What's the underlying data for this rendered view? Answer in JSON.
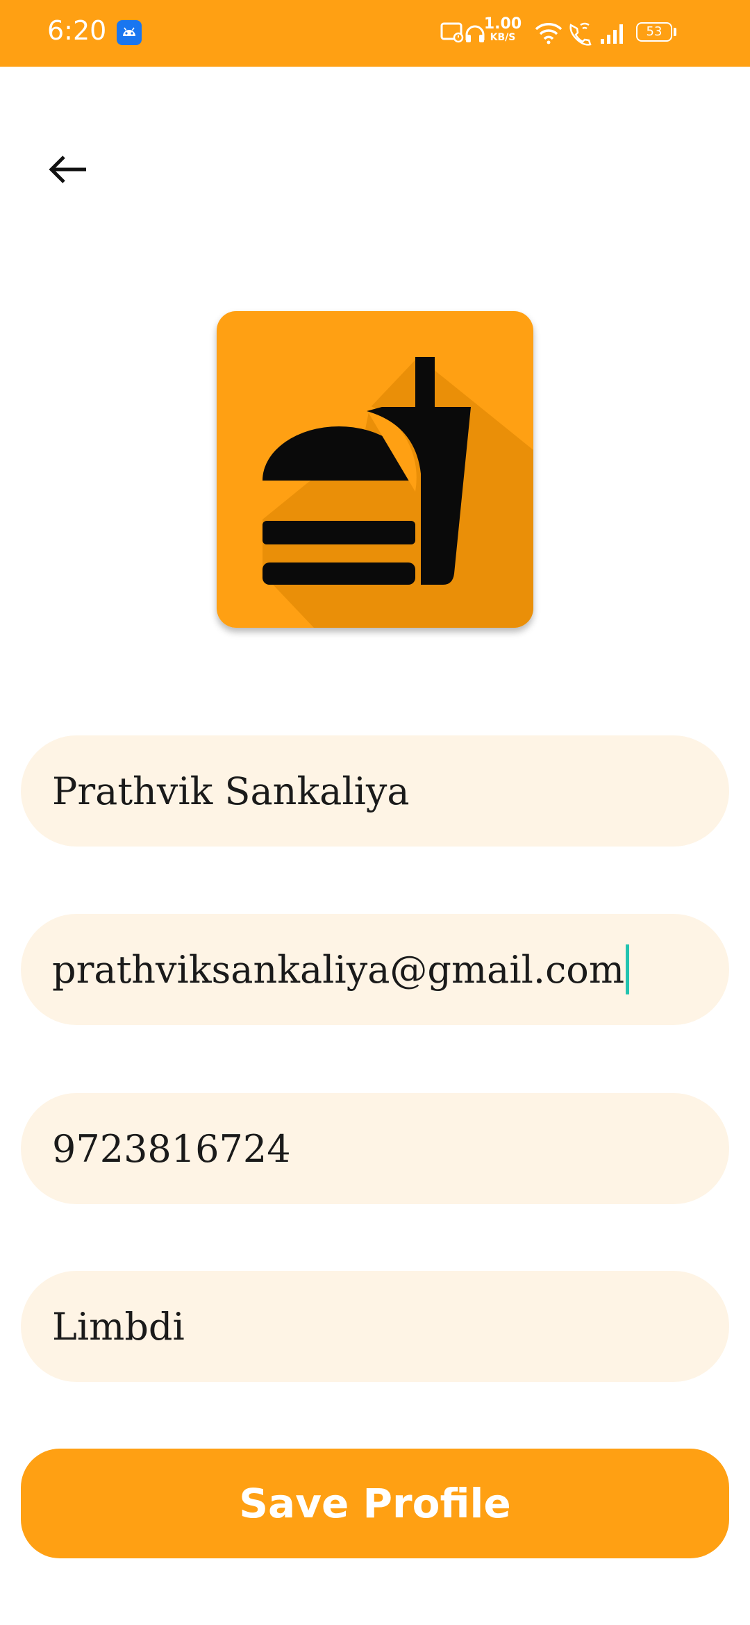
{
  "status_bar": {
    "time": "6:20",
    "net_speed_value": "1.00",
    "net_speed_unit": "KB/S",
    "battery_level": "53",
    "icons": [
      "android-notification-icon",
      "cast-icon",
      "headphones-icon",
      "wifi-icon",
      "wifi-calling-icon",
      "signal-icon",
      "battery-icon"
    ]
  },
  "header": {
    "back_icon": "arrow-left-icon"
  },
  "logo": {
    "icon": "fastfood-icon",
    "colors": {
      "background": "#FFA013",
      "glyph": "#0a0a0a"
    }
  },
  "form": {
    "name_value": "Prathvik Sankaliya",
    "email_value": "prathviksankaliya@gmail.com",
    "phone_value": "9723816724",
    "city_value": "Limbdi",
    "save_label": "Save Profile"
  },
  "colors": {
    "accent": "#FFA013",
    "field_background": "#FEF4E5",
    "caret": "#22C3B0",
    "text": "#1a1a1a"
  }
}
